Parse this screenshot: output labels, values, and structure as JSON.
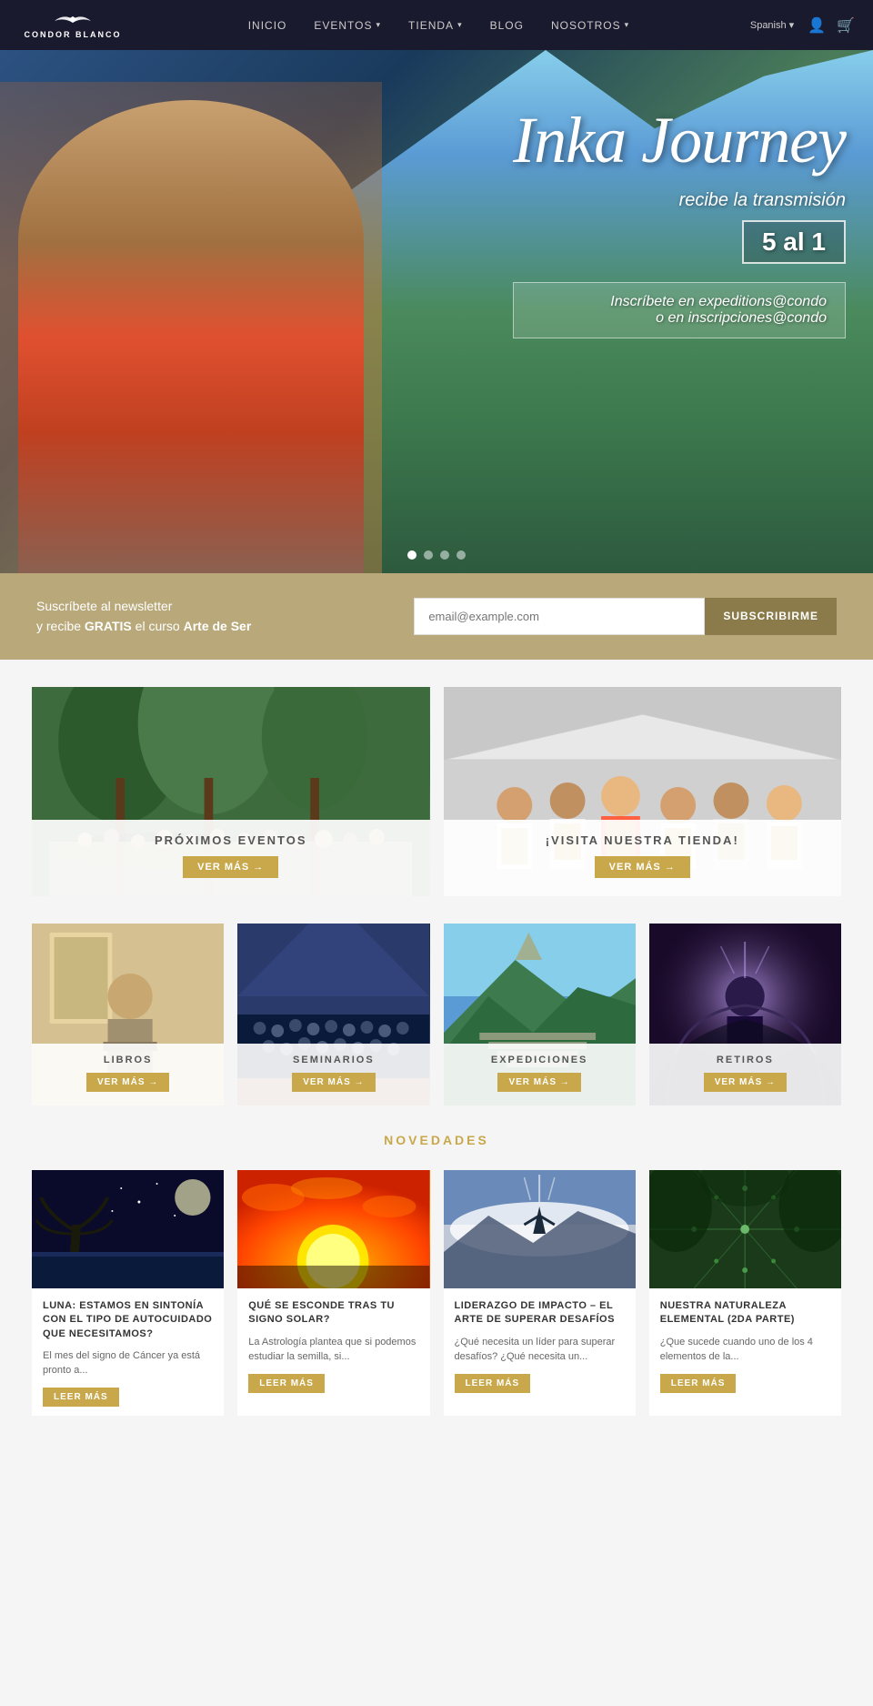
{
  "brand": {
    "name": "CONDOR BLANCO",
    "bird_unicode": "〰"
  },
  "header": {
    "language": "Spanish",
    "nav": [
      {
        "label": "INICIO",
        "has_dropdown": false
      },
      {
        "label": "EVENTOS",
        "has_dropdown": true
      },
      {
        "label": "TIENDA",
        "has_dropdown": true
      },
      {
        "label": "BLOG",
        "has_dropdown": false
      },
      {
        "label": "NOSOTROS",
        "has_dropdown": true
      }
    ]
  },
  "hero": {
    "title": "Inka Journey",
    "subtitle": "recibe la transmisión",
    "dates": "5 al 1",
    "contact_line1": "Inscríbete en expeditions@condo",
    "contact_line2": "o en inscripciones@condo",
    "dots": [
      "active",
      "",
      "",
      ""
    ]
  },
  "newsletter": {
    "text_line1": "Suscríbete al newsletter",
    "text_line2_prefix": "y recibe ",
    "text_bold": "GRATIS",
    "text_line2_suffix": " el curso ",
    "text_bold2": "Arte de Ser",
    "input_placeholder": "email@example.com",
    "button_label": "SUBSCRIBIRME"
  },
  "promo_cards": [
    {
      "id": "events",
      "title": "PRÓXIMOS EVENTOS",
      "btn_label": "VER MÁS →"
    },
    {
      "id": "shop",
      "title": "¡VISITA NUESTRA TIENDA!",
      "btn_label": "VER MÁS →"
    }
  ],
  "categories": [
    {
      "id": "libros",
      "title": "LIBROS",
      "btn_label": "VER MÁS →"
    },
    {
      "id": "seminarios",
      "title": "SEMINARIOS",
      "btn_label": "VER MÁS →"
    },
    {
      "id": "expediciones",
      "title": "EXPEDICIONES",
      "btn_label": "VER MÁS →"
    },
    {
      "id": "retiros",
      "title": "RETIROS",
      "btn_label": "VER MÁS →"
    }
  ],
  "novedades": {
    "section_title": "NOVEDADES",
    "articles": [
      {
        "id": "luna",
        "title": "LUNA: ESTAMOS EN SINTONÍA CON EL TIPO DE AUTOCUIDADO QUE NECESITAMOS?",
        "excerpt": "El mes del signo de Cáncer ya está pronto a...",
        "btn_label": "LEER MÁS"
      },
      {
        "id": "signo",
        "title": "QUÉ SE ESCONDE TRAS TU SIGNO SOLAR?",
        "excerpt": "La Astrología plantea que si podemos estudiar la semilla, si...",
        "btn_label": "LEER MÁS"
      },
      {
        "id": "liderazgo",
        "title": "LIDERAZGO DE IMPACTO – EL ARTE DE SUPERAR DESAFÍOS",
        "excerpt": "¿Qué necesita un líder para superar desafíos? ¿Qué necesita un...",
        "btn_label": "LEER MÁS"
      },
      {
        "id": "naturaleza",
        "title": "NUESTRA NATURALEZA ELEMENTAL (2DA PARTE)",
        "excerpt": "¿Que sucede cuando uno de los 4 elementos de la...",
        "btn_label": "LEER MÁS"
      }
    ]
  }
}
